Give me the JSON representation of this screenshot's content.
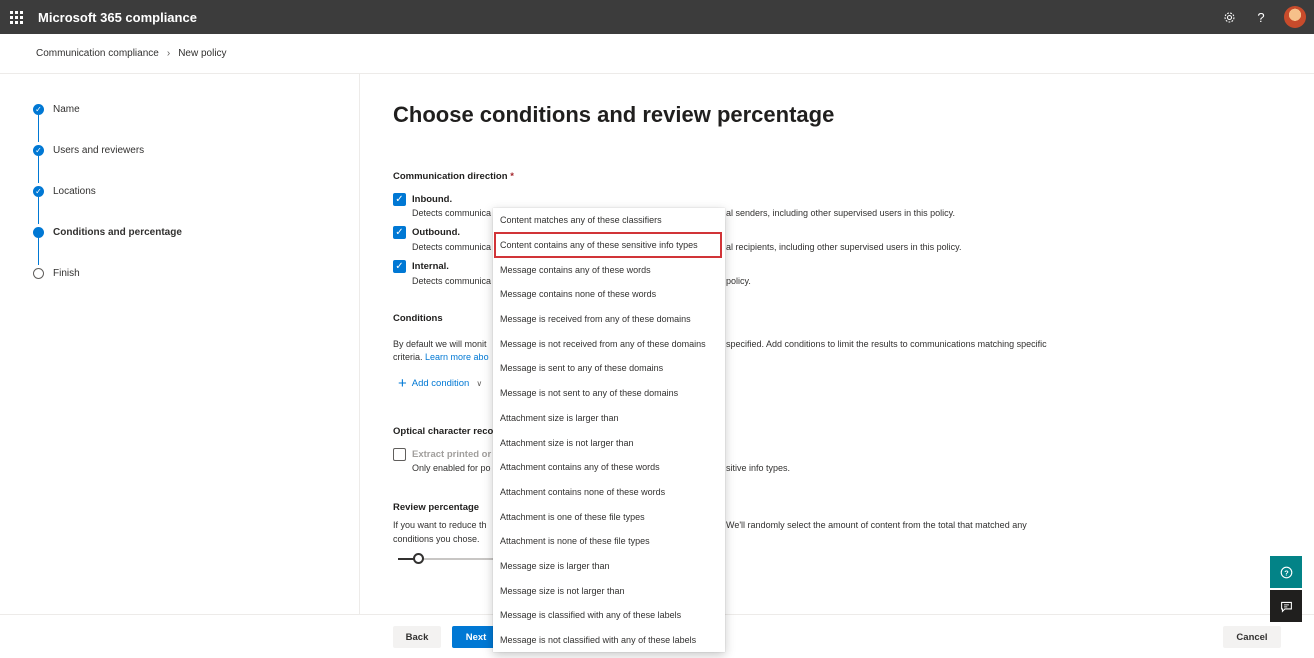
{
  "app": {
    "title": "Microsoft 365 compliance"
  },
  "topbar": {
    "settings_icon": "gear-icon",
    "help_icon": "question-icon",
    "help_glyph": "?"
  },
  "breadcrumb": {
    "items": [
      "Communication compliance",
      "New policy"
    ],
    "separator": "›"
  },
  "wizard": {
    "steps": [
      {
        "label": "Name",
        "state": "done"
      },
      {
        "label": "Users and reviewers",
        "state": "done"
      },
      {
        "label": "Locations",
        "state": "done"
      },
      {
        "label": "Conditions and percentage",
        "state": "current"
      },
      {
        "label": "Finish",
        "state": "pending"
      }
    ]
  },
  "main": {
    "title": "Choose conditions and review percentage",
    "direction": {
      "label": "Communication direction",
      "required_mark": "*",
      "options": [
        {
          "title": "Inbound.",
          "desc_left": "Detects communica",
          "desc_right": "al senders, including other supervised users in this policy.",
          "checked": true
        },
        {
          "title": "Outbound.",
          "desc_left": "Detects communica",
          "desc_right": "al recipients, including other supervised users in this policy.",
          "checked": true
        },
        {
          "title": "Internal.",
          "desc_left": "Detects communica",
          "desc_right": "policy.",
          "checked": true
        }
      ]
    },
    "conditions": {
      "label": "Conditions",
      "desc_left": "By default we will monit",
      "desc_right": "specified. Add conditions to limit the results to communications matching specific",
      "desc_line2": "criteria.",
      "learn_more": "Learn more abo",
      "add_condition": "Add condition"
    },
    "ocr": {
      "label": "Optical character recog",
      "option_title": "Extract printed or",
      "desc_left": "Only enabled for po",
      "desc_right": "sitive info types.",
      "checked": false
    },
    "review": {
      "label": "Review percentage",
      "desc_left": "If you want to reduce th",
      "desc_right": "We'll randomly select the amount of content from the total that matched any",
      "desc_line2": "conditions you chose.",
      "slider_fraction": 0.2
    }
  },
  "dropdown": {
    "items": [
      "Content matches any of these classifiers",
      "Content contains any of these sensitive info types",
      "Message contains any of these words",
      "Message contains none of these words",
      "Message is received from any of these domains",
      "Message is not received from any of these domains",
      "Message is sent to any of these domains",
      "Message is not sent to any of these domains",
      "Attachment size is larger than",
      "Attachment size is not larger than",
      "Attachment contains any of these words",
      "Attachment contains none of these words",
      "Attachment is one of these file types",
      "Attachment is none of these file types",
      "Message size is larger than",
      "Message size is not larger than",
      "Message is classified with any of these labels",
      "Message is not classified with any of these labels"
    ],
    "highlighted_index": 1,
    "highlight_color": "#d13438"
  },
  "footer": {
    "back": "Back",
    "next": "Next",
    "cancel": "Cancel"
  },
  "side": {
    "help_icon": "help-circle-icon",
    "help_glyph": "?",
    "feedback_icon": "feedback-icon"
  },
  "colors": {
    "accent": "#0078d4",
    "topbar": "#3c3c3c",
    "help_teal": "#038387"
  }
}
